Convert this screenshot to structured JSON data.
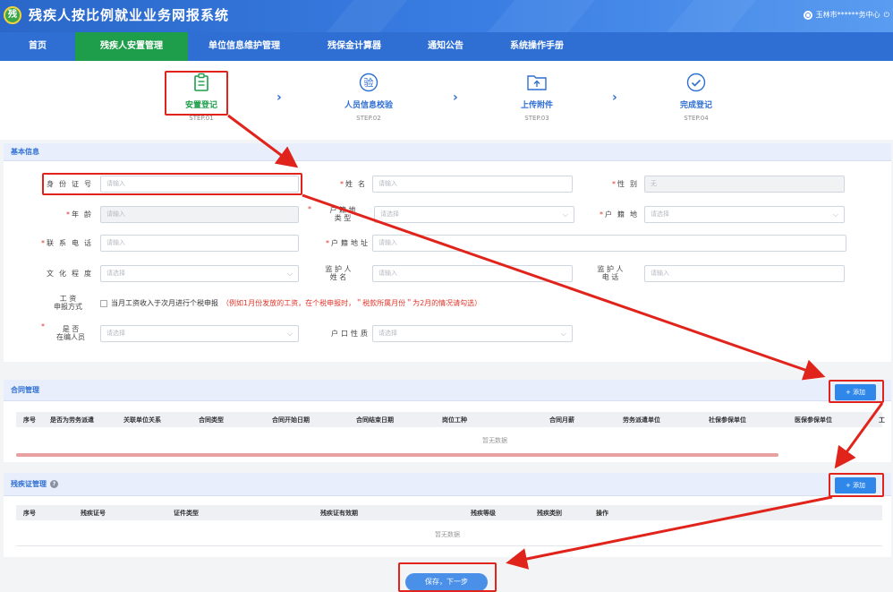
{
  "app": {
    "title": "残疾人按比例就业业务网报系统",
    "logo_text": "残",
    "user": "玉林市******务中心",
    "power_icon": "⏻"
  },
  "nav": [
    {
      "label": "首页",
      "active": false
    },
    {
      "label": "残疾人安置管理",
      "active": true
    },
    {
      "label": "单位信息维护管理",
      "active": false
    },
    {
      "label": "残保金计算器",
      "active": false
    },
    {
      "label": "通知公告",
      "active": false
    },
    {
      "label": "系统操作手册",
      "active": false
    }
  ],
  "steps": [
    {
      "label": "安置登记",
      "sub": "STEP.01",
      "icon": "clipboard-icon",
      "active": true
    },
    {
      "label": "人员信息校验",
      "sub": "STEP.02",
      "icon": "verify-icon",
      "icon_text": "验",
      "active": false
    },
    {
      "label": "上传附件",
      "sub": "STEP.03",
      "icon": "upload-folder-icon",
      "active": false
    },
    {
      "label": "完成登记",
      "sub": "STEP.04",
      "icon": "check-circle-icon",
      "active": false
    }
  ],
  "step_arrow": "›",
  "basic": {
    "title": "基本信息",
    "id_label": "身份证号",
    "id_placeholder": "请输入",
    "name_label": "姓名",
    "name_placeholder": "请输入",
    "gender_label": "性别",
    "gender_value": "无",
    "age_label": "年龄",
    "age_placeholder": "请输入",
    "hukou_type_label_1": "户 籍 地",
    "hukou_type_label_2": "类 型",
    "hukou_type_placeholder": "请选择",
    "hukou_label": "户籍地",
    "hukou_placeholder": "请选择",
    "phone_label": "联系电话",
    "phone_placeholder": "请输入",
    "address_label": "户籍地址",
    "address_placeholder": "请输入",
    "edu_label": "文化程度",
    "edu_placeholder": "请选择",
    "guardian_name_label_1": "监 护 人",
    "guardian_name_label_2": "姓 名",
    "guardian_name_placeholder": "请输入",
    "guardian_phone_label_1": "监 护 人",
    "guardian_phone_label_2": "电 话",
    "guardian_phone_placeholder": "请输入",
    "wage_label_1": "工 资",
    "wage_label_2": "申报方式",
    "wage_text": "当月工资收入于次月进行个税申报",
    "wage_note": "（例如1月份发放的工资，在个税申报时，＂税款所属月份＂为2月的情况请勾选）",
    "staff_label_1": "是 否",
    "staff_label_2": "在编人员",
    "staff_placeholder": "请选择",
    "hukou_nature_label": "户口性质",
    "hukou_nature_placeholder": "请选择",
    "required_mark": "*",
    "chevron": "⌵"
  },
  "contract": {
    "title": "合同管理",
    "add_label": "+ 添加",
    "columns": [
      "序号",
      "是否为劳务派遣",
      "关联单位关系",
      "合同类型",
      "合同开始日期",
      "合同结束日期",
      "岗位工种",
      "合同月薪",
      "劳务派遣单位",
      "社保参保单位",
      "医保参保单位",
      "工"
    ],
    "empty": "暂无数据"
  },
  "disability": {
    "title": "残疾证管理",
    "help_icon": "?",
    "add_label": "+ 添加",
    "columns": [
      "序号",
      "残疾证号",
      "证件类型",
      "残疾证有效期",
      "残疾等级",
      "残疾类别",
      "操作"
    ],
    "empty": "暂无数据"
  },
  "save_label": "保存，下一步",
  "colors": {
    "primary": "#2f6fd3",
    "active_green": "#1e9e4a",
    "annotation_red": "#e0241b"
  }
}
